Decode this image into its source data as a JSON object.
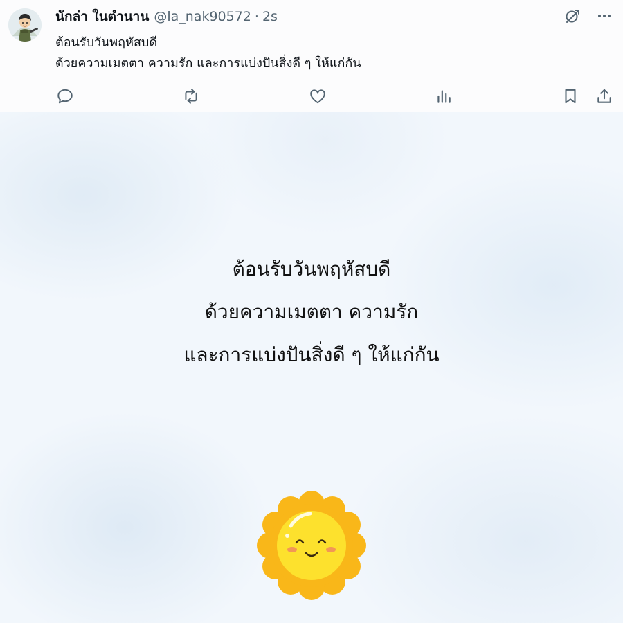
{
  "post": {
    "display_name": "นักล่า ในตำนาน",
    "handle": "@la_nak90572",
    "separator": "·",
    "timestamp": "2s",
    "text_lines": [
      "ต้อนรับวันพฤหัสบดี",
      "ด้วยความเมตตา ความรัก และการแบ่งปันสิ่งดี ๆ ให้แก่กัน"
    ]
  },
  "header_icons": [
    "grok-icon",
    "more-icon"
  ],
  "actions": [
    "reply-icon",
    "repost-icon",
    "like-icon",
    "views-icon",
    "bookmark-icon",
    "share-icon"
  ],
  "media": {
    "lines": [
      "ต้อนรับวันพฤหัสบดี",
      "ด้วยความเมตตา ความรัก",
      "และการแบ่งปันสิ่งดี ๆ ให้แก่กัน"
    ]
  },
  "colors": {
    "text_primary": "#0f1419",
    "text_secondary": "#536471",
    "sun_yellow": "#fde12d",
    "sun_orange": "#f9b719"
  }
}
